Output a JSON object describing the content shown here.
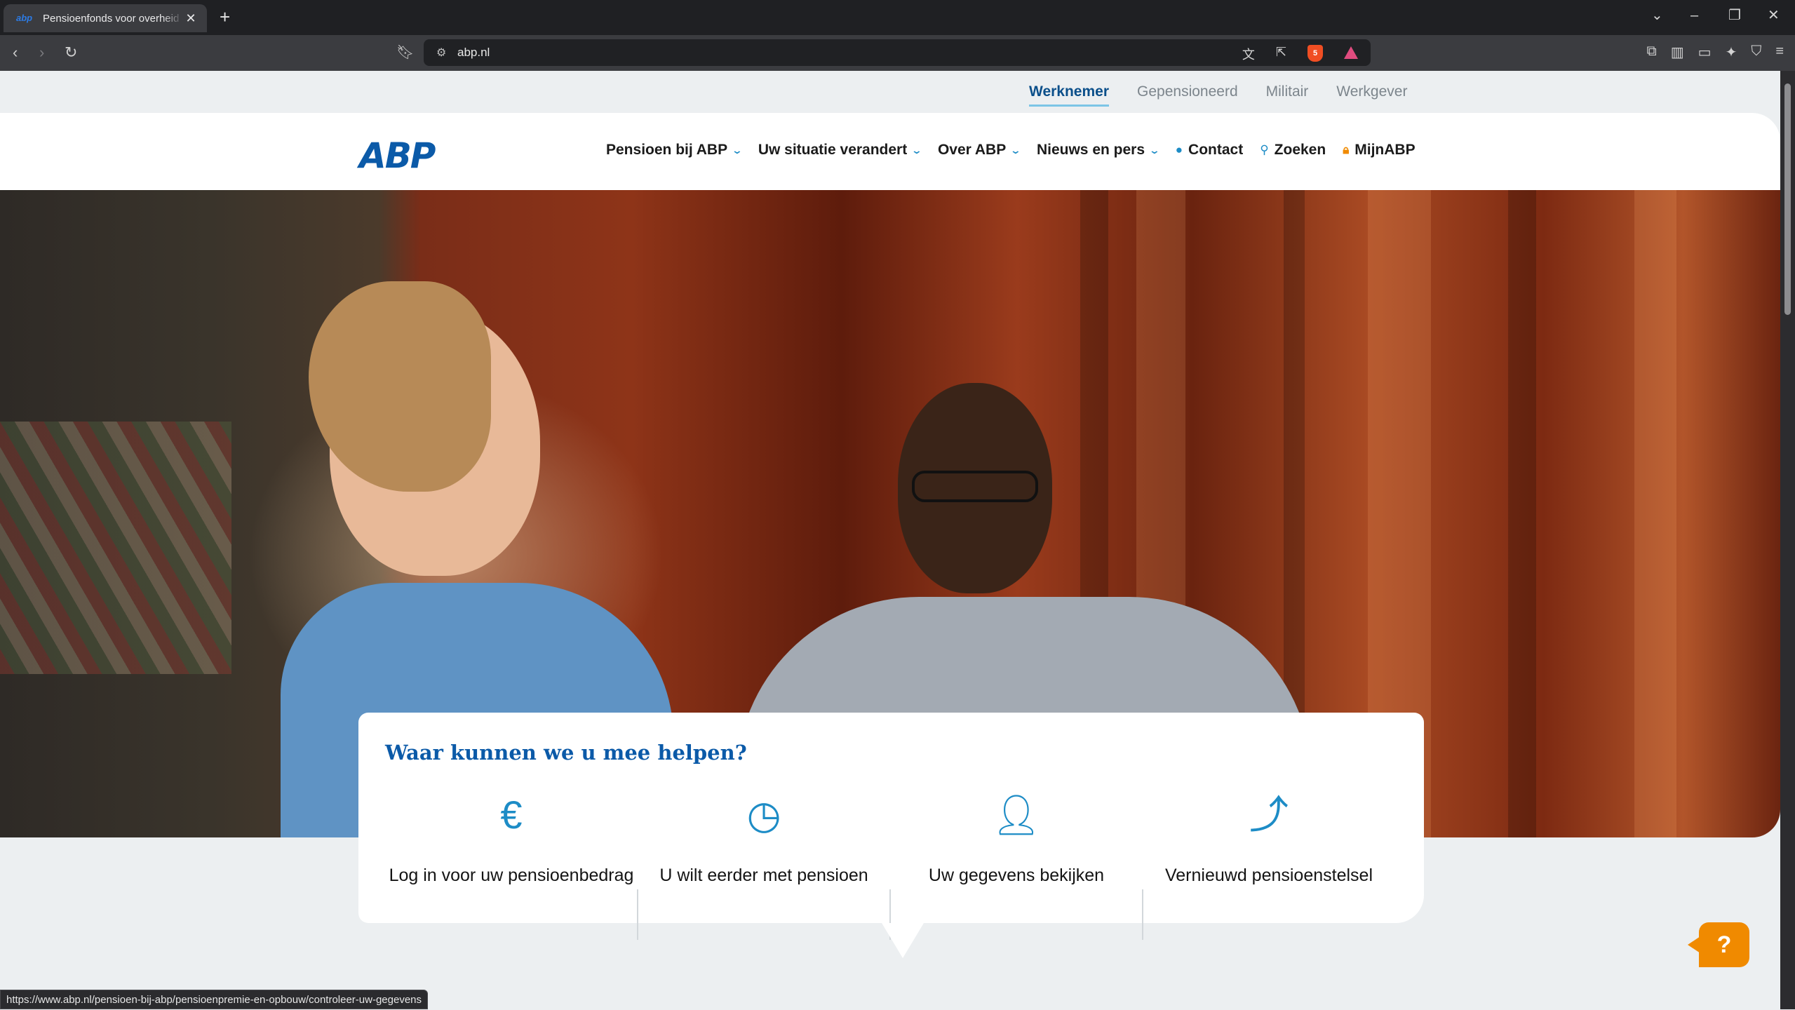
{
  "browser": {
    "tab_title": "Pensioenfonds voor overheid en onderwijs",
    "tab_close": "✕",
    "new_tab": "+",
    "url": "abp.nl",
    "status_url": "https://www.abp.nl/pensioen-bij-abp/pensioenpremie-en-opbouw/controleer-uw-gegevens",
    "brave_badge": "5"
  },
  "audience_nav": {
    "items": [
      {
        "label": "Werknemer",
        "active": true
      },
      {
        "label": "Gepensioneerd"
      },
      {
        "label": "Militair"
      },
      {
        "label": "Werkgever"
      }
    ]
  },
  "header": {
    "logo": "ABP",
    "menu": [
      {
        "label": "Pensioen bij ABP"
      },
      {
        "label": "Uw situatie verandert"
      },
      {
        "label": "Over ABP"
      },
      {
        "label": "Nieuws en pers"
      },
      {
        "label": "Contact"
      },
      {
        "label": "Zoeken"
      },
      {
        "label": "MijnABP"
      }
    ]
  },
  "help": {
    "title": "Waar kunnen we u mee helpen?",
    "items": [
      {
        "label": "Log in voor uw pensioenbedrag",
        "icon": "euro-icon"
      },
      {
        "label": "U wilt eerder met pensioen",
        "icon": "history-clock-icon"
      },
      {
        "label": "Uw gegevens bekijken",
        "icon": "user-settings-icon"
      },
      {
        "label": "Vernieuwd pensioenstelsel",
        "icon": "merge-arrow-icon"
      }
    ],
    "fab_label": "?"
  },
  "colors": {
    "brand_blue": "#0b5aa8",
    "accent_blue": "#1d8cc6",
    "accent_orange": "#f08a00"
  }
}
